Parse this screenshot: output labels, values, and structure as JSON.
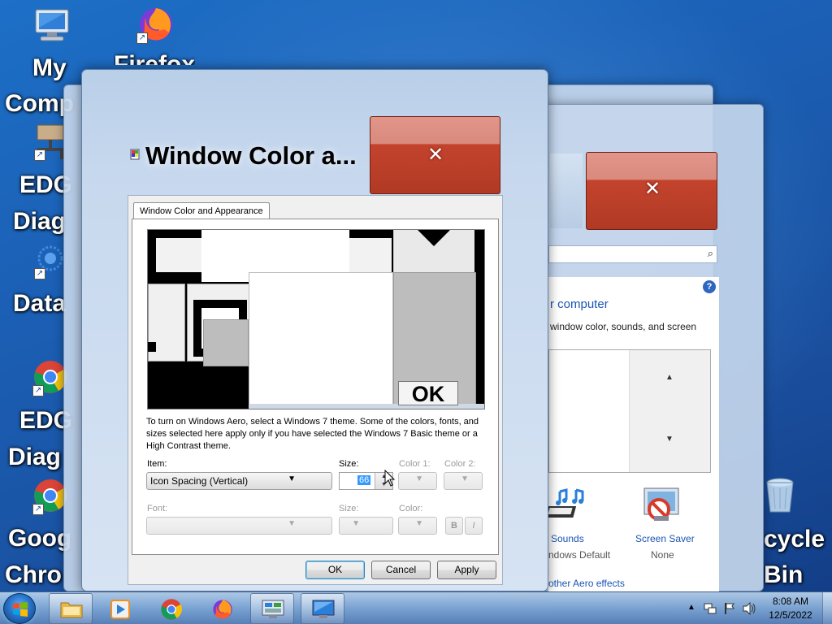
{
  "desktop": {
    "icons": [
      {
        "label_line1": "My",
        "label_line2": "Comp"
      },
      {
        "label_line1": "Firefox"
      },
      {
        "label_line1": "EDG",
        "label_line2": "Diag"
      },
      {
        "label_line1": "Data"
      },
      {
        "label_line1": "EDG",
        "label_line2": "Diag"
      },
      {
        "label_line1": "Goog",
        "label_line2": "Chro"
      },
      {
        "label_line1": "cycle",
        "label_line2": "Bin"
      }
    ]
  },
  "personalization": {
    "link_computer": "r computer",
    "subtitle": "window color, sounds, and screen",
    "help_icon": "?",
    "sounds_label": "Sounds",
    "sounds_value": "ndows Default",
    "screensaver_label": "Screen Saver",
    "screensaver_value": "None",
    "aero_link": "other Aero effects"
  },
  "dialog": {
    "title": "Window Color a...",
    "tab": "Window Color and Appearance",
    "preview_ok": "OK",
    "description": "To turn on Windows Aero, select a Windows 7 theme.  Some of the colors, fonts, and sizes selected here apply only if you have selected the Windows 7 Basic theme or a High Contrast theme.",
    "item_label": "Item:",
    "item_value": "Icon Spacing (Vertical)",
    "size_label": "Size:",
    "size_value": "66",
    "color1_label": "Color 1:",
    "color2_label": "Color 2:",
    "font_label": "Font:",
    "font_size_label": "Size:",
    "font_color_label": "Color:",
    "bold_label": "B",
    "italic_label": "I",
    "ok_button": "OK",
    "cancel_button": "Cancel",
    "apply_button": "Apply"
  },
  "taskbar": {
    "time": "8:08 AM",
    "date": "12/5/2022"
  },
  "colors": {
    "desktop": "#1b5fb4",
    "close_button": "#c4432d",
    "link": "#1a55b5",
    "selection": "#3399ff"
  }
}
